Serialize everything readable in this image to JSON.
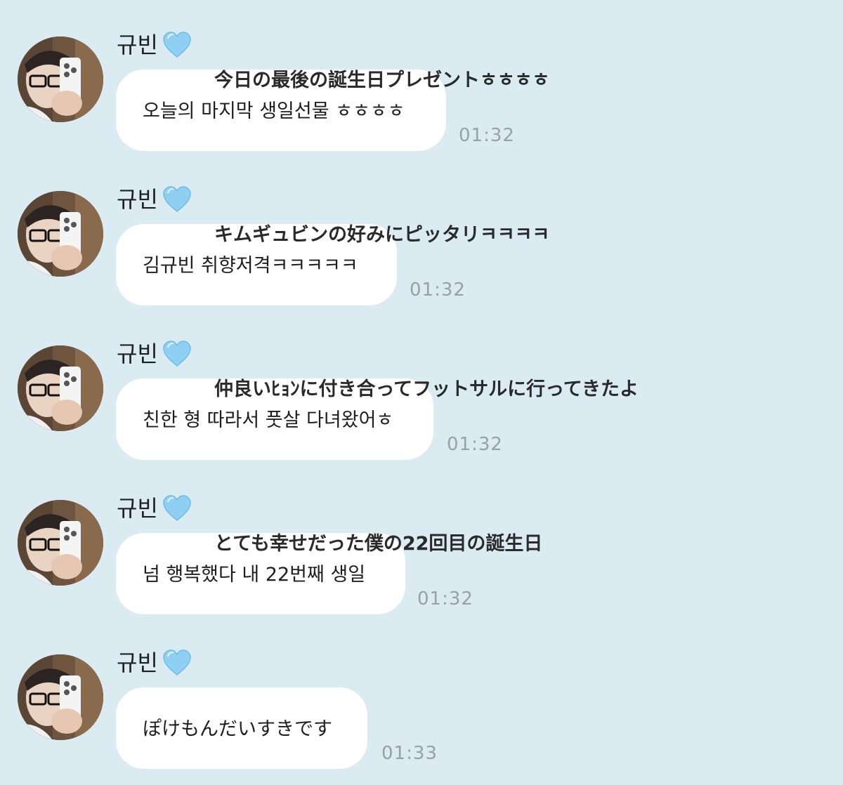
{
  "colors": {
    "background": "#dbebf2",
    "bubble": "#ffffff",
    "timestamp": "#9aa0a4",
    "heart": "#8fd0f2"
  },
  "messages": [
    {
      "sender": "규빈",
      "icon": "light-blue-heart-icon",
      "text": "오늘의 마지막 생일선물 ㅎㅎㅎㅎ",
      "translation": "今日の最後の誕生日プレゼントㅎㅎㅎㅎ",
      "time": "01:32"
    },
    {
      "sender": "규빈",
      "icon": "light-blue-heart-icon",
      "text": "김규빈 취향저격ㅋㅋㅋㅋㅋ",
      "translation": "キムギュビンの好みにピッタリㅋㅋㅋㅋ",
      "time": "01:32"
    },
    {
      "sender": "규빈",
      "icon": "light-blue-heart-icon",
      "text": "친한 형 따라서 풋살 다녀왔어ㅎ",
      "translation": "仲良いﾋｮﾝに付き合ってフットサルに行ってきたよ",
      "time": "01:32"
    },
    {
      "sender": "규빈",
      "icon": "light-blue-heart-icon",
      "text": "넘 행복했다 내 22번째 생일",
      "translation": "とても幸せだった僕の22回目の誕生日",
      "time": "01:32"
    },
    {
      "sender": "규빈",
      "icon": "light-blue-heart-icon",
      "text": "ぽけもんだいすきです",
      "translation": "",
      "time": "01:33"
    }
  ]
}
